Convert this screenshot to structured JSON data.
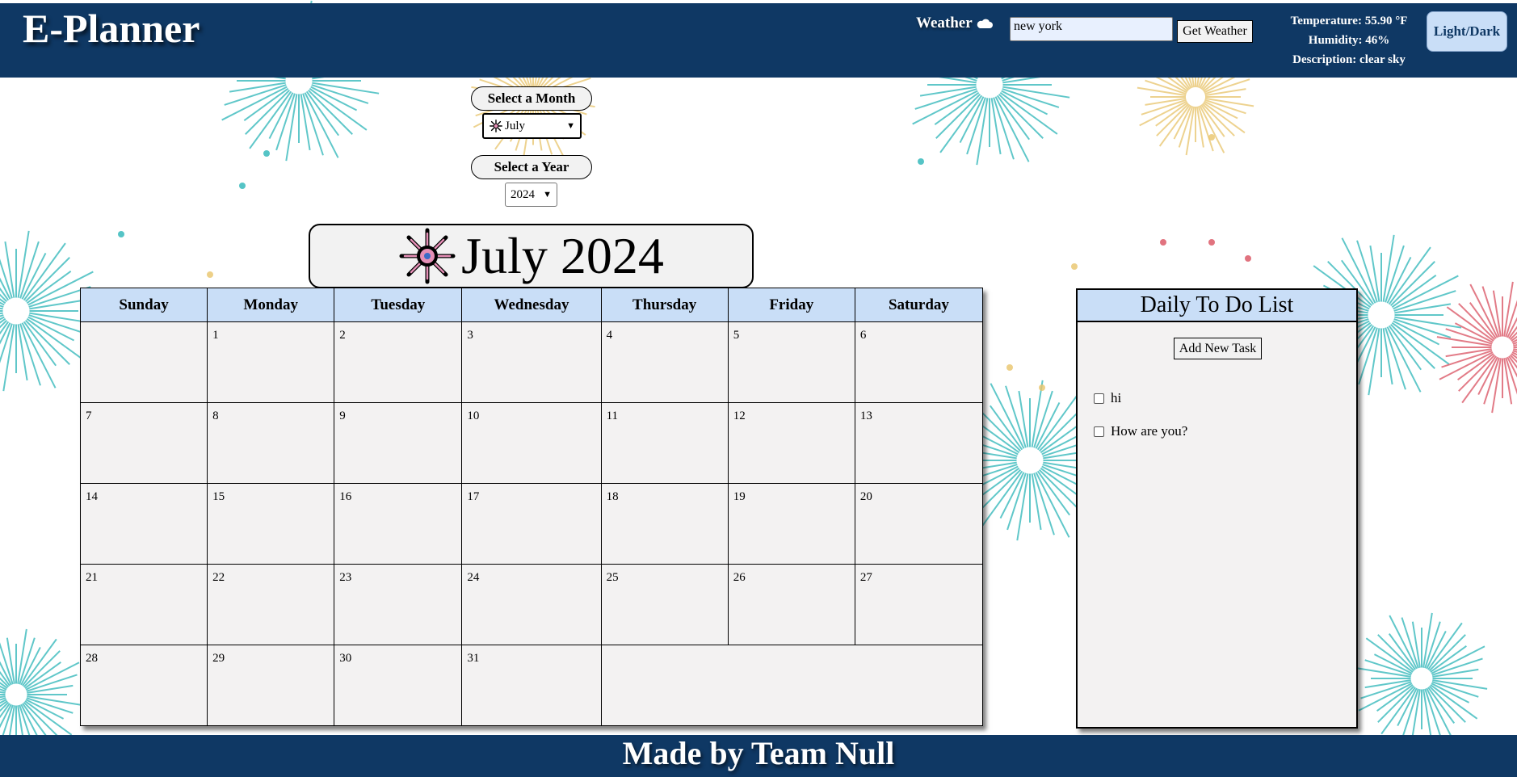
{
  "header": {
    "app_title": "E-Planner",
    "weather_label": "Weather",
    "weather_icon": "cloud-icon",
    "city_value": "new york",
    "city_placeholder": "",
    "get_weather_label": "Get Weather",
    "temperature": "Temperature: 55.90 °F",
    "humidity": "Humidity: 46%",
    "description": "Description: clear sky",
    "theme_toggle_label": "Light/Dark"
  },
  "selectors": {
    "month_title": "Select a Month",
    "month_value": "July",
    "month_icon": "firework-icon",
    "year_title": "Select a Year",
    "year_value": "2024"
  },
  "calendar": {
    "banner": "July 2024",
    "banner_icon": "firework-icon",
    "weekdays": [
      "Sunday",
      "Monday",
      "Tuesday",
      "Wednesday",
      "Thursday",
      "Friday",
      "Saturday"
    ],
    "weeks": [
      [
        "",
        "1",
        "2",
        "3",
        "4",
        "5",
        "6"
      ],
      [
        "7",
        "8",
        "9",
        "10",
        "11",
        "12",
        "13"
      ],
      [
        "14",
        "15",
        "16",
        "17",
        "18",
        "19",
        "20"
      ],
      [
        "21",
        "22",
        "23",
        "24",
        "25",
        "26",
        "27"
      ],
      [
        "28",
        "29",
        "30",
        "31"
      ]
    ]
  },
  "todo": {
    "title": "Daily To Do List",
    "add_label": "Add New Task",
    "tasks": [
      {
        "text": "hi",
        "checked": false
      },
      {
        "text": "How are you?",
        "checked": false
      }
    ]
  },
  "footer": {
    "text": "Made by Team Null"
  },
  "colors": {
    "header_bg": "#0f3864",
    "cell_header_bg": "#c9def7",
    "cell_bg": "#f3f2f2",
    "firework_teal": "#2bb5b8",
    "firework_gold": "#e8c46a",
    "firework_red": "#d9505f"
  }
}
